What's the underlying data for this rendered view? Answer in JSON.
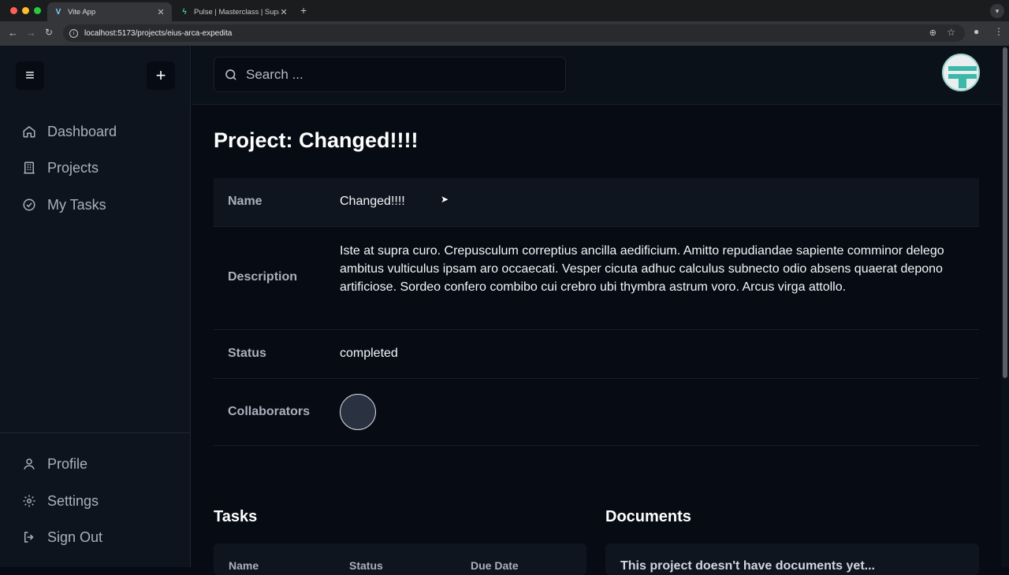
{
  "browser": {
    "tabs": [
      {
        "title": "Vite App",
        "active": true
      },
      {
        "title": "Pulse | Masterclass | Supabase",
        "active": false
      }
    ],
    "url": "localhost:5173/projects/eius-arca-expedita"
  },
  "sidebar": {
    "items": [
      {
        "label": "Dashboard",
        "icon": "home-icon"
      },
      {
        "label": "Projects",
        "icon": "building-icon"
      },
      {
        "label": "My Tasks",
        "icon": "check-circle-icon"
      }
    ],
    "bottom_items": [
      {
        "label": "Profile",
        "icon": "user-icon"
      },
      {
        "label": "Settings",
        "icon": "gear-icon"
      },
      {
        "label": "Sign Out",
        "icon": "sign-out-icon"
      }
    ]
  },
  "search": {
    "placeholder": "Search ..."
  },
  "project": {
    "title": "Project: Changed!!!!",
    "fields": {
      "name_label": "Name",
      "name": "Changed!!!!",
      "description_label": "Description",
      "description": "Iste at supra curo. Crepusculum correptius ancilla aedificium. Amitto repudiandae sapiente comminor delego ambitus vulticulus ipsam aro occaecati. Vesper cicuta adhuc calculus subnecto odio absens quaerat depono artificiose. Sordeo confero combibo cui crebro ubi thymbra astrum voro. Arcus virga attollo.",
      "status_label": "Status",
      "status": "completed",
      "collaborators_label": "Collaborators"
    }
  },
  "tasks": {
    "title": "Tasks",
    "columns": [
      "Name",
      "Status",
      "Due Date"
    ]
  },
  "documents": {
    "title": "Documents",
    "empty_message": "This project doesn't have documents yet..."
  },
  "colors": {
    "background": "#060b14",
    "sidebar": "#0e141d",
    "accent": "#3bb8a8"
  }
}
